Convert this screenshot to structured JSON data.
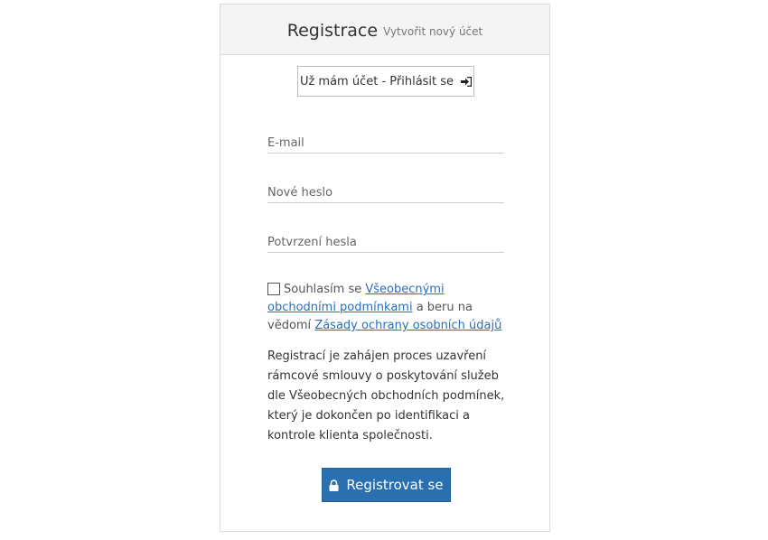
{
  "header": {
    "title": "Registrace",
    "subtitle": "Vytvořit nový účet"
  },
  "login_button": {
    "label": "Už mám účet - Přihlásit se",
    "icon": "sign-in-icon"
  },
  "form": {
    "email_placeholder": "E-mail",
    "email_value": "",
    "password_placeholder": "Nové heslo",
    "password_value": "",
    "confirm_placeholder": "Potvrzení hesla",
    "confirm_value": ""
  },
  "consent": {
    "checked": false,
    "text_before": "Souhlasím se ",
    "link_terms": "Všeobecnými obchodními podmínkami",
    "text_middle": " a beru na vědomí ",
    "link_privacy": "Zásady ochrany osobních údajů"
  },
  "info_text": "Registrací je zahájen proces uzavření rámcové smlouvy o poskytování služeb dle Všeobecných obchodních podmínek, který je dokončen po identifikaci a kontrole klienta společnosti.",
  "register_button": {
    "label": "Registrovat se",
    "icon": "lock-icon"
  },
  "colors": {
    "primary": "#2a70b0",
    "link": "#2a6ebb",
    "header_bg": "#f4f4f4"
  }
}
